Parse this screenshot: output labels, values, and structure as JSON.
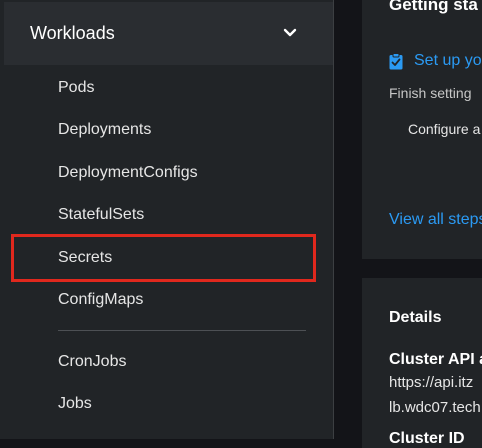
{
  "sidebar": {
    "section": {
      "label": "Workloads",
      "expanded": true
    },
    "items": [
      {
        "label": "Pods"
      },
      {
        "label": "Deployments"
      },
      {
        "label": "DeploymentConfigs"
      },
      {
        "label": "StatefulSets"
      },
      {
        "label": "Secrets"
      },
      {
        "label": "ConfigMaps"
      },
      {
        "label": "CronJobs"
      },
      {
        "label": "Jobs"
      }
    ]
  },
  "getting_started": {
    "title": "Getting sta",
    "task_title": "Set up yo",
    "task_desc": "Finish setting",
    "task_item": "Configure a",
    "view_all": "View all steps"
  },
  "details": {
    "title": "Details",
    "cluster_api_label": "Cluster API a",
    "cluster_api_value_1": "https://api.itz",
    "cluster_api_value_2": "lb.wdc07.tech",
    "cluster_id_label": "Cluster ID"
  },
  "colors": {
    "highlight": "#e0281d",
    "link": "#2b9af3",
    "sidebar_bg": "#212427",
    "page_bg": "#131418"
  }
}
